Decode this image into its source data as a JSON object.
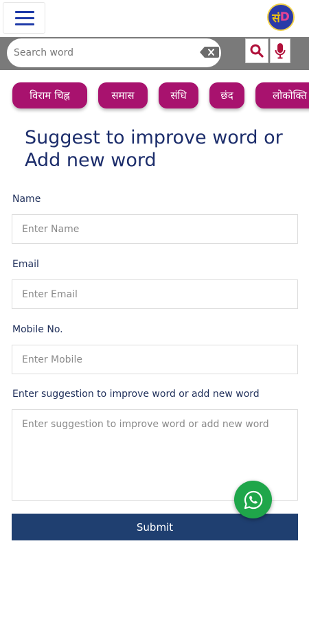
{
  "header": {
    "menu_icon": "hamburger-menu-icon",
    "logo_text_part1": "सं",
    "logo_text_part2": "D"
  },
  "search": {
    "placeholder": "Search word",
    "value": "",
    "clear_icon": "backspace-clear-icon",
    "search_icon": "search-icon",
    "mic_icon": "microphone-icon"
  },
  "chips": [
    {
      "label": "विराम चिह्न"
    },
    {
      "label": "समास"
    },
    {
      "label": "संधि"
    },
    {
      "label": "छंद"
    },
    {
      "label": "लोकोक्ति"
    }
  ],
  "form": {
    "title": "Suggest to improve word or Add new word",
    "name_label": "Name",
    "name_placeholder": "Enter Name",
    "email_label": "Email",
    "email_placeholder": "Enter Email",
    "mobile_label": "Mobile No.",
    "mobile_placeholder": "Enter Mobile",
    "suggestion_label": "Enter suggestion to improve word or add new word",
    "suggestion_placeholder": "Enter suggestion to improve word or add new word",
    "submit_label": "Submit"
  },
  "floating": {
    "whatsapp_icon": "whatsapp-icon"
  },
  "colors": {
    "chip_bg": "#a8126e",
    "title_color": "#1c2d6b",
    "submit_bg": "#1f3f70",
    "whatsapp_bg": "#1fa64a",
    "search_bar_bg": "#7a7a7a"
  }
}
